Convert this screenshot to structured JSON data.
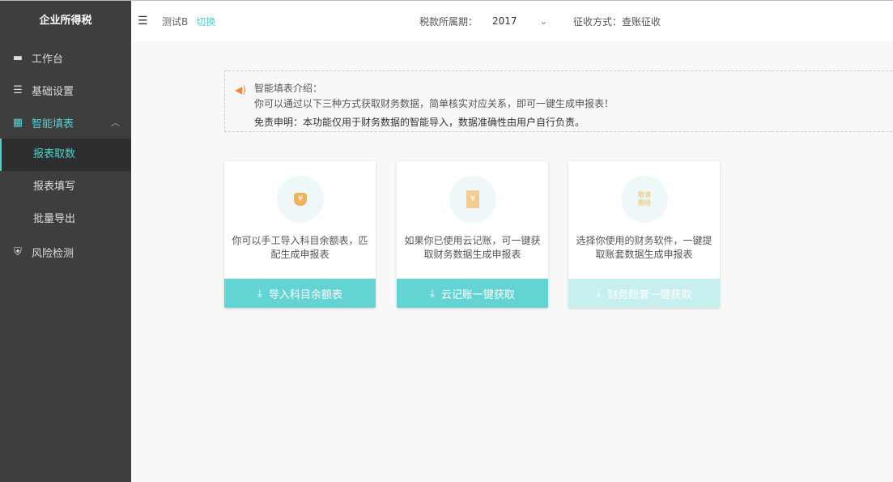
{
  "sidebar": {
    "title": "企业所得税",
    "items": [
      {
        "label": "工作台"
      },
      {
        "label": "基础设置"
      },
      {
        "label": "智能填表",
        "sub": [
          {
            "label": "报表取数"
          },
          {
            "label": "报表填写"
          },
          {
            "label": "批量导出"
          }
        ]
      },
      {
        "label": "风险检测"
      }
    ]
  },
  "header": {
    "company": "测试B",
    "switch": "切换",
    "period_label": "税款所属期：",
    "year": "2017",
    "method": "征收方式：查账征收"
  },
  "notice": {
    "title": "智能填表介绍：",
    "line": "你可以通过以下三种方式获取财务数据，简单核实对应关系，即可一键生成申报表！",
    "disclaimer": "免责申明：本功能仅用于财务数据的智能导入，数据准确性由用户自行负责。"
  },
  "cards": [
    {
      "desc": "你可以手工导入科目余额表，匹配生成申报表",
      "button": "导入科目余额表",
      "icon_text": "¥"
    },
    {
      "desc": "如果你已使用云记账，可一键获取财务数据生成申报表",
      "button": "云记账一键获取",
      "icon_text": "¥"
    },
    {
      "desc": "选择你使用的财务软件，一键提取账套数据生成申报表",
      "button": "财务账套一键获取",
      "icon_text": "敬请期待"
    }
  ]
}
